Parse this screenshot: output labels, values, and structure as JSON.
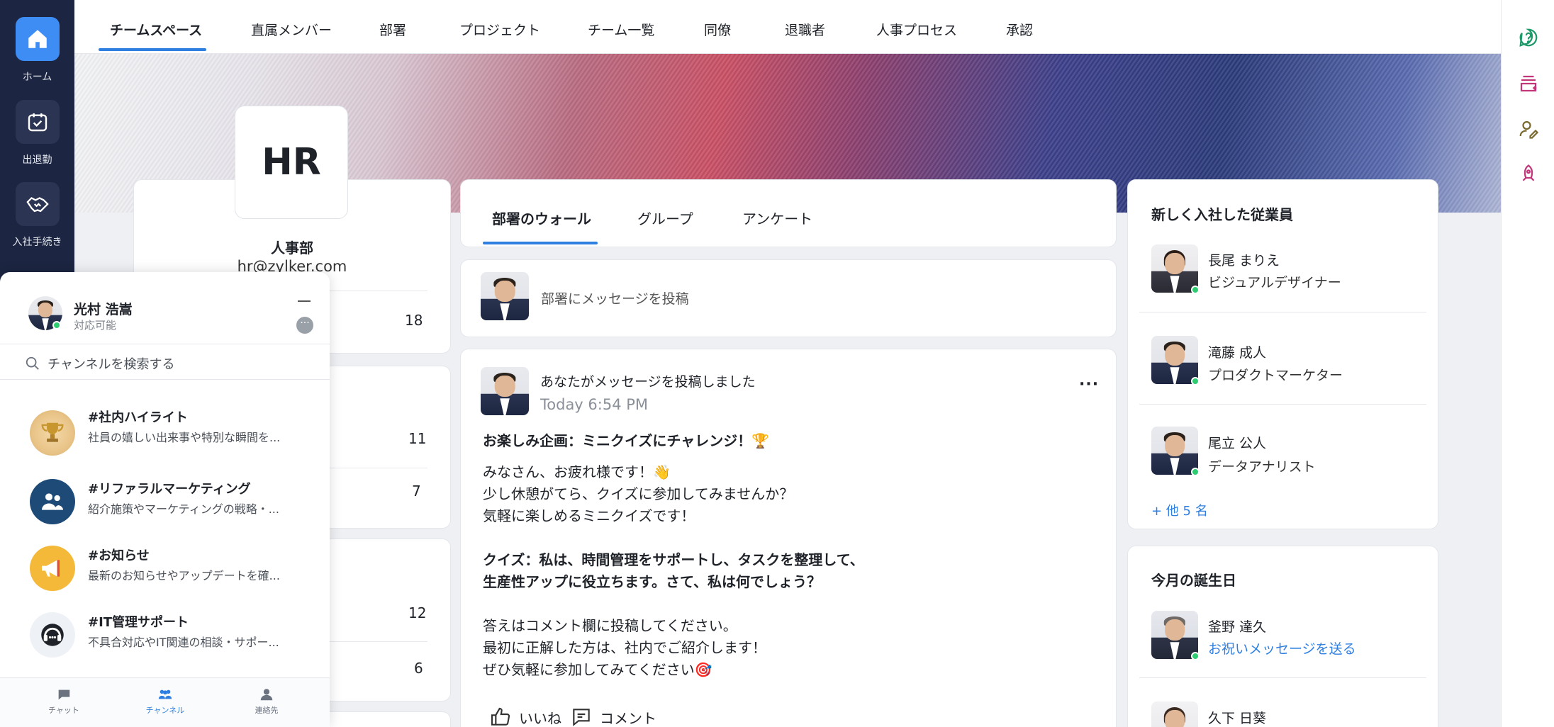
{
  "rail": {
    "items": [
      {
        "label": "ホーム",
        "icon": "home-icon"
      },
      {
        "label": "出退勤",
        "icon": "calendar-check-icon"
      },
      {
        "label": "入社手続き",
        "icon": "handshake-icon"
      }
    ]
  },
  "topnav": {
    "tabs": [
      "チームスペース",
      "直属メンバー",
      "部署",
      "プロジェクト",
      "チーム一覧",
      "同僚",
      "退職者",
      "人事プロセス",
      "承認"
    ]
  },
  "dept": {
    "logo": "HR",
    "name": "人事部",
    "email": "hr@zylker.com",
    "counts": [
      "18",
      "11",
      "7",
      "12",
      "6"
    ]
  },
  "middle": {
    "tabs": [
      "部署のウォール",
      "グループ",
      "アンケート"
    ],
    "compose_placeholder": "部署にメッセージを投稿",
    "post": {
      "author_line": "あなたがメッセージを投稿しました",
      "time": "Today 6:54 PM",
      "title": "お楽しみ企画：ミニクイズにチャレンジ！🏆",
      "lines": [
        "みなさん、お疲れ様です！👋",
        "少し休憩がてら、クイズに参加してみませんか？",
        "気軽に楽しめるミニクイズです！"
      ],
      "quiz_lines": [
        "クイズ：私は、時間管理をサポートし、タスクを整理して、",
        "生産性アップに役立ちます。さて、私は何でしょう？"
      ],
      "closing_lines": [
        "答えはコメント欄に投稿してください。",
        "最初に正解した方は、社内でご紹介します！",
        "ぜひ気軽に参加してみてください🎯"
      ],
      "like_label": "いいね",
      "comment_label": "コメント"
    }
  },
  "new_hires": {
    "title": "新しく入社した従業員",
    "people": [
      {
        "name": "長尾 まりえ",
        "role": "ビジュアルデザイナー"
      },
      {
        "name": "滝藤 成人",
        "role": "プロダクトマーケター"
      },
      {
        "name": "尾立 公人",
        "role": "データアナリスト"
      }
    ],
    "more": "+ 他 5 名"
  },
  "birthdays": {
    "title": "今月の誕生日",
    "people": [
      {
        "name": "釜野 達久",
        "action": "お祝いメッセージを送る"
      },
      {
        "name": "久下 日葵"
      }
    ]
  },
  "chat": {
    "user_name": "光村 浩嵩",
    "status": "対応可能",
    "search_placeholder": "チャンネルを検索する",
    "channels": [
      {
        "name": "#社内ハイライト",
        "desc": "社員の嬉しい出来事や特別な瞬間を...",
        "icon": "trophy-icon"
      },
      {
        "name": "#リファラルマーケティング",
        "desc": "紹介施策やマーケティングの戦略・...",
        "icon": "people-icon"
      },
      {
        "name": "#お知らせ",
        "desc": "最新のお知らせやアップデートを確...",
        "icon": "megaphone-icon"
      },
      {
        "name": "#IT管理サポート",
        "desc": "不具合対応やIT関連の相談・サポー...",
        "icon": "headset-icon"
      }
    ],
    "footer": [
      "チャット",
      "チャンネル",
      "連絡先"
    ]
  },
  "colors": {
    "accent": "#2f7fe0",
    "rail": "#1c2541",
    "online": "#2ecc71"
  }
}
